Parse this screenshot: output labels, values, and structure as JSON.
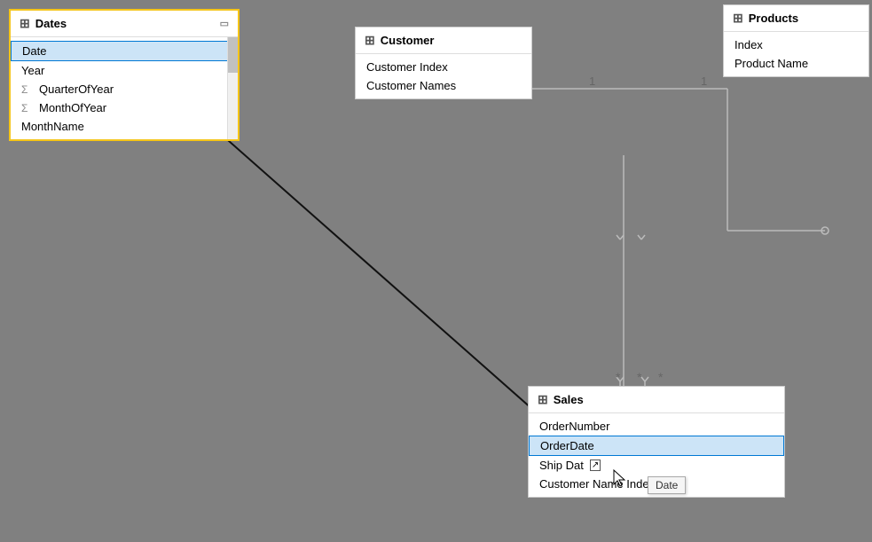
{
  "tables": {
    "dates": {
      "title": "Dates",
      "fields": [
        {
          "name": "Date",
          "type": "plain",
          "selected": true
        },
        {
          "name": "Year",
          "type": "plain",
          "selected": false
        },
        {
          "name": "QuarterOfYear",
          "type": "sigma",
          "selected": false
        },
        {
          "name": "MonthOfYear",
          "type": "sigma",
          "selected": false
        },
        {
          "name": "MonthName",
          "type": "plain",
          "selected": false
        }
      ]
    },
    "customer": {
      "title": "Customer",
      "fields": [
        {
          "name": "Customer Index",
          "type": "plain",
          "selected": false
        },
        {
          "name": "Customer Names",
          "type": "plain",
          "selected": false
        }
      ]
    },
    "products": {
      "title": "Products",
      "fields": [
        {
          "name": "Index",
          "type": "plain",
          "selected": false
        },
        {
          "name": "Product Name",
          "type": "plain",
          "selected": false
        }
      ]
    },
    "sales": {
      "title": "Sales",
      "fields": [
        {
          "name": "OrderNumber",
          "type": "plain",
          "selected": false
        },
        {
          "name": "OrderDate",
          "type": "plain",
          "selected": true
        },
        {
          "name": "Ship Date",
          "type": "plain",
          "selected": false
        },
        {
          "name": "Customer Name Index",
          "type": "plain",
          "selected": false
        }
      ]
    }
  },
  "tooltip": {
    "text": "Date"
  },
  "relationship_labels": {
    "one_left": "1",
    "one_right": "1",
    "many_left": "*",
    "many_mid": "*",
    "many_right": "*"
  }
}
